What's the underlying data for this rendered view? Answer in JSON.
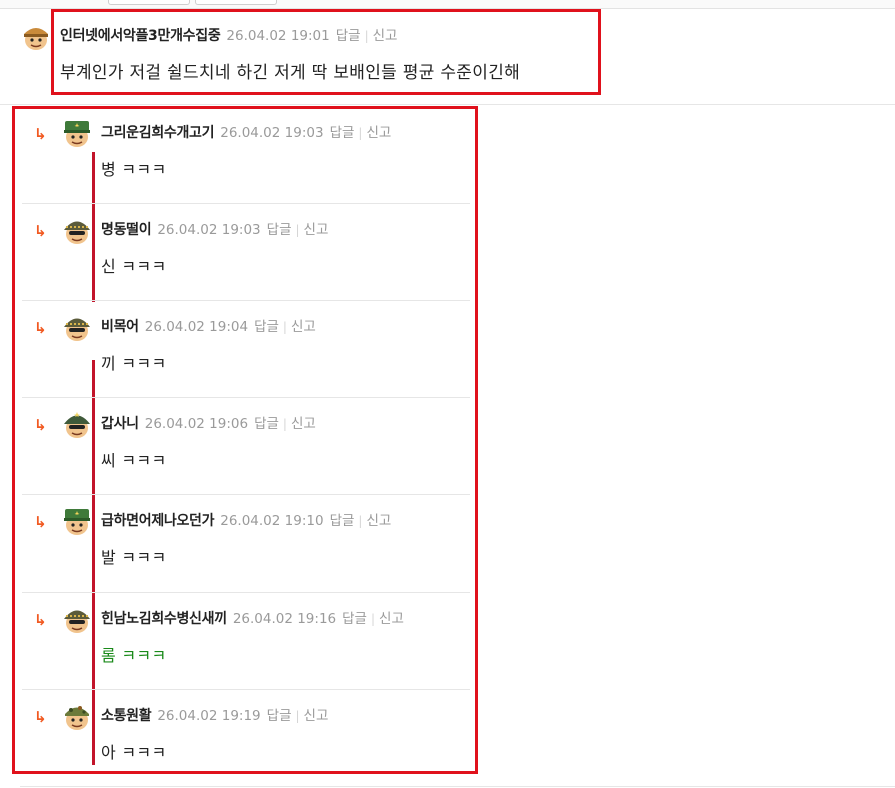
{
  "top_comment": {
    "nick": "인터넷에서악플3만개수집중",
    "date": "26.04.02 19:01",
    "reply": "답글",
    "report": "신고",
    "text": "부계인가 저걸 쉴드치네 하긴 저게 딱 보배인들 평균 수준이긴해"
  },
  "replies": [
    {
      "nick": "그리운김희수개고기",
      "date": "26.04.02 19:03",
      "reply": "답글",
      "report": "신고",
      "text": "병 ㅋㅋㅋ",
      "avatar": "soldier-green-cap"
    },
    {
      "nick": "명동떨이",
      "date": "26.04.02 19:03",
      "reply": "답글",
      "report": "신고",
      "text": "신 ㅋㅋㅋ",
      "avatar": "soldier-helmet"
    },
    {
      "nick": "비목어",
      "date": "26.04.02 19:04",
      "reply": "답글",
      "report": "신고",
      "text": "끼 ㅋㅋㅋ",
      "avatar": "soldier-helmet-star"
    },
    {
      "nick": "갑사니",
      "date": "26.04.02 19:06",
      "reply": "답글",
      "report": "신고",
      "text": "씨 ㅋㅋㅋ",
      "avatar": "soldier-star-cap"
    },
    {
      "nick": "급하면어제나오던가",
      "date": "26.04.02 19:10",
      "reply": "답글",
      "report": "신고",
      "text": "발 ㅋㅋㅋ",
      "avatar": "soldier-green-cap"
    },
    {
      "nick": "힌남노김희수병신새끼",
      "date": "26.04.02 19:16",
      "reply": "답글",
      "report": "신고",
      "text": "롬 ㅋㅋㅋ",
      "avatar": "soldier-helmet"
    },
    {
      "nick": "소통원활",
      "date": "26.04.02 19:19",
      "reply": "답글",
      "report": "신고",
      "text": "아 ㅋㅋㅋ",
      "avatar": "soldier-camo"
    }
  ],
  "colors": {
    "highlight_border": "#e0111c",
    "thread_line": "#c2142a",
    "reply_arrow": "#f15a22",
    "meta_text": "#9a9a9a",
    "green_text": "#1a8a1a"
  },
  "icons": {
    "reply_arrow": "↳"
  }
}
